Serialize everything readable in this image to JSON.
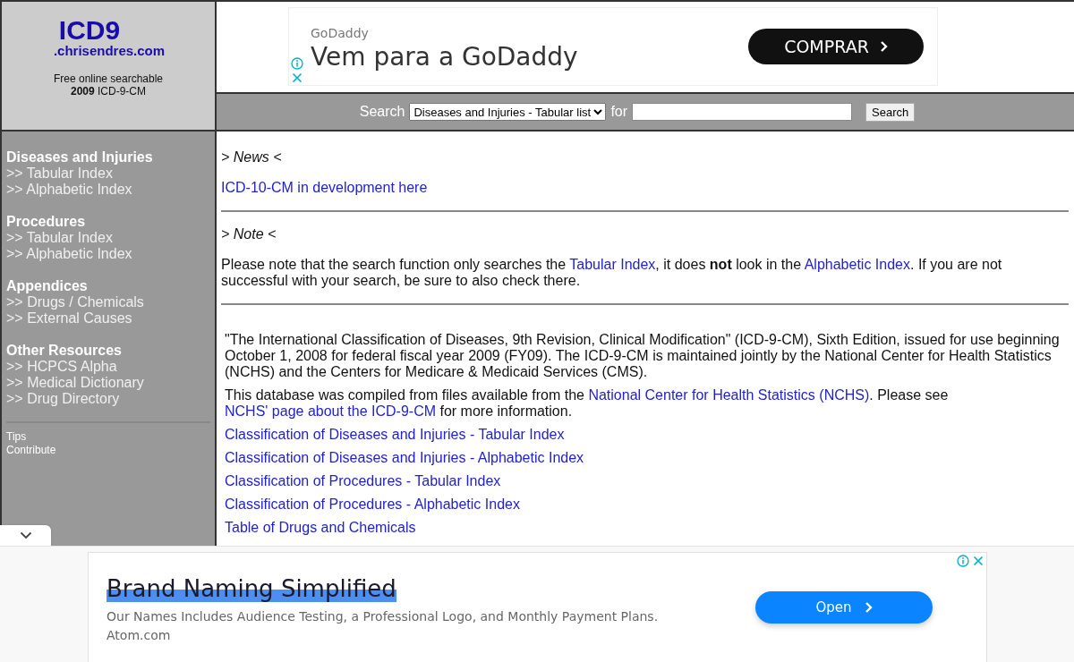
{
  "header": {
    "logo_title": "ICD9",
    "logo_domain": ".chrisendres.com",
    "tagline": [
      "Free online searchable",
      "**2009** ICD-9-CM"
    ]
  },
  "top_ad": {
    "brand": "GoDaddy",
    "headline": "Vem para a GoDaddy",
    "button": "COMPRAR"
  },
  "search_bar": {
    "label": "Search",
    "select_value": "Diseases and Injuries - Tabular list",
    "for_label": "for",
    "button": "Search"
  },
  "sidebar": {
    "sections": [
      {
        "heading": "Diseases and Injuries",
        "links": [
          ">> Tabular Index",
          ">> Alphabetic Index"
        ]
      },
      {
        "heading": "Procedures",
        "links": [
          ">> Tabular Index",
          ">> Alphabetic Index"
        ]
      },
      {
        "heading": "Appendices",
        "links": [
          ">> Drugs / Chemicals",
          ">> External Causes"
        ]
      },
      {
        "heading": "Other Resources",
        "links": [
          ">> HCPCS Alpha",
          ">> Medical Dictionary",
          ">> Drug Directory"
        ]
      }
    ],
    "footer_links": [
      "Tips",
      "Contribute"
    ]
  },
  "content": {
    "news_heading": "> News <",
    "news_link": "ICD-10-CM in development here",
    "note_heading": "> Note <",
    "note_text": [
      {
        "kind": "text",
        "text": "Please note that the search function only searches the "
      },
      {
        "kind": "link",
        "text": "Tabular Index"
      },
      {
        "kind": "text",
        "text": ", it does **not** look in the "
      },
      {
        "kind": "link",
        "text": "Alphabetic Index"
      },
      {
        "kind": "text",
        "text": ". If you are not successful with your search, be sure to also check there."
      }
    ],
    "intro": "\"The International Classification of Diseases, 9th Revision, Clinical Modification\" (ICD-9-CM), Sixth Edition, issued for use beginning October 1, 2008 for federal fiscal year 2009 (FY09). The ICD-9-CM is maintained jointly by the National Center for Health Statistics (NCHS) and the Centers for Medicare & Medicaid Services (CMS).",
    "source_text": [
      {
        "kind": "text",
        "text": "This database was compiled from files available from the "
      },
      {
        "kind": "link",
        "text": "National Center for Health Statistics (NCHS)"
      },
      {
        "kind": "text",
        "text": ". Please see "
      },
      {
        "kind": "link",
        "text": "NCHS' page about the ICD-9-CM"
      },
      {
        "kind": "text",
        "text": " for more information."
      }
    ],
    "links": [
      "Classification of Diseases and Injuries - Tabular Index",
      "Classification of Diseases and Injuries - Alphabetic Index",
      "Classification of Procedures - Tabular Index",
      "Classification of Procedures - Alphabetic Index",
      "Table of Drugs and Chemicals"
    ]
  },
  "bottom_ad": {
    "headline": "Brand Naming Simplified",
    "text": "Our Names Includes Audience Testing, a Professional Logo, and Monthly Payment Plans.",
    "domain": "Atom.com",
    "button": "Open"
  }
}
